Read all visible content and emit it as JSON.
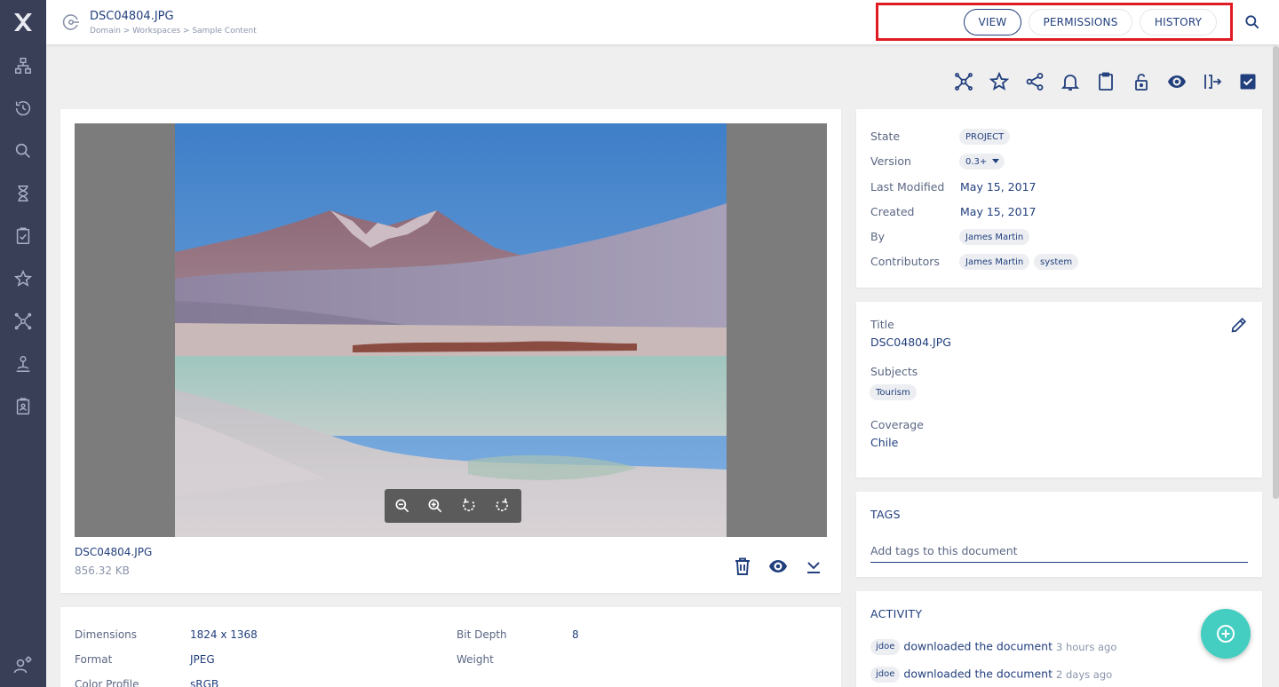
{
  "header": {
    "title": "DSC04804.JPG",
    "breadcrumb": "Domain > Workspaces > Sample Content",
    "tabs": [
      {
        "label": "VIEW",
        "active": true
      },
      {
        "label": "PERMISSIONS",
        "active": false
      },
      {
        "label": "HISTORY",
        "active": false
      }
    ]
  },
  "sidebar": {
    "items": [
      "browse-icon",
      "history-icon",
      "search-icon",
      "hourglass-icon",
      "tasks-icon",
      "favorites-icon",
      "collections-icon",
      "lock-icon",
      "clipboard-icon"
    ],
    "bottom": "user-settings-icon"
  },
  "toolbar": {
    "icons": [
      "add-to-collection-icon",
      "favorite-icon",
      "share-icon",
      "notify-icon",
      "clipboard-icon",
      "lock-icon",
      "preview-icon",
      "publish-icon",
      "select-icon"
    ]
  },
  "file": {
    "name": "DSC04804.JPG",
    "size": "856.32 KB"
  },
  "metadata": {
    "state_label": "State",
    "state_value": "PROJECT",
    "version_label": "Version",
    "version_value": "0.3+",
    "last_modified_label": "Last Modified",
    "last_modified_value": "May 15, 2017",
    "created_label": "Created",
    "created_value": "May 15, 2017",
    "by_label": "By",
    "by_value": "James Martin",
    "contributors_label": "Contributors",
    "contributors": [
      "James Martin",
      "system"
    ]
  },
  "info": {
    "title_label": "Title",
    "title_value": "DSC04804.JPG",
    "subjects_label": "Subjects",
    "subjects": [
      "Tourism"
    ],
    "coverage_label": "Coverage",
    "coverage_value": "Chile"
  },
  "tags": {
    "heading": "TAGS",
    "placeholder": "Add tags to this document"
  },
  "activity": {
    "heading": "ACTIVITY",
    "items": [
      {
        "user": "jdoe",
        "action": "downloaded the document",
        "time": "3 hours ago"
      },
      {
        "user": "jdoe",
        "action": "downloaded the document",
        "time": "2 days ago"
      }
    ]
  },
  "properties": {
    "dimensions_label": "Dimensions",
    "dimensions_value": "1824 x 1368",
    "format_label": "Format",
    "format_value": "JPEG",
    "color_profile_label": "Color Profile",
    "color_profile_value": "sRGB",
    "bit_depth_label": "Bit Depth",
    "bit_depth_value": "8",
    "weight_label": "Weight"
  },
  "colors": {
    "sidebar": "#3a3f58",
    "primary": "#213f7d",
    "accent": "#43cec1",
    "highlight_border": "#e01b22"
  }
}
